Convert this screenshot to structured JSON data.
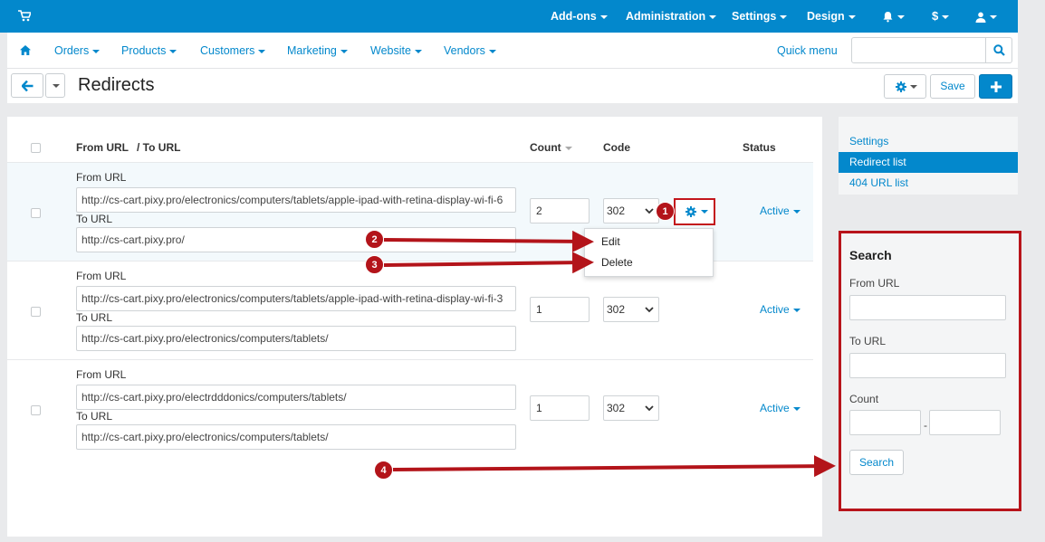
{
  "topbar": {
    "menus": [
      "Add-ons",
      "Administration",
      "Settings",
      "Design"
    ],
    "currency": "$",
    "icons": [
      "cart-icon",
      "bell-icon",
      "user-icon"
    ]
  },
  "subnav": {
    "items": [
      "Orders",
      "Products",
      "Customers",
      "Marketing",
      "Website",
      "Vendors"
    ],
    "quick_menu": "Quick menu",
    "search_placeholder": ""
  },
  "header": {
    "title": "Redirects",
    "save_label": "Save"
  },
  "table": {
    "headers": {
      "from_url": "From URL",
      "to_url": "/ To URL",
      "count": "Count",
      "code": "Code",
      "status": "Status"
    },
    "from_label": "From URL",
    "to_label": "To URL",
    "rows": [
      {
        "from_url": "http://cs-cart.pixy.pro/electronics/computers/tablets/apple-ipad-with-retina-display-wi-fi-6",
        "to_url": "http://cs-cart.pixy.pro/",
        "count": "2",
        "code": "302",
        "status": "Active"
      },
      {
        "from_url": "http://cs-cart.pixy.pro/electronics/computers/tablets/apple-ipad-with-retina-display-wi-fi-3",
        "to_url": "http://cs-cart.pixy.pro/electronics/computers/tablets/",
        "count": "1",
        "code": "302",
        "status": "Active"
      },
      {
        "from_url": "http://cs-cart.pixy.pro/electrdddonics/computers/tablets/",
        "to_url": "http://cs-cart.pixy.pro/electronics/computers/tablets/",
        "count": "1",
        "code": "302",
        "status": "Active"
      }
    ]
  },
  "dropdown": {
    "items": [
      "Edit",
      "Delete"
    ]
  },
  "sidebar": {
    "items": [
      "Settings",
      "Redirect list",
      "404 URL list"
    ],
    "active": "Redirect list"
  },
  "search_panel": {
    "title": "Search",
    "from_label": "From URL",
    "to_label": "To URL",
    "count_label": "Count",
    "range_separator": "-",
    "button": "Search"
  },
  "annotations": {
    "badges": [
      "1",
      "2",
      "3",
      "4"
    ],
    "color": "#b3141a"
  },
  "colors": {
    "accent": "#0388cc",
    "highlight": "#b8141b"
  }
}
